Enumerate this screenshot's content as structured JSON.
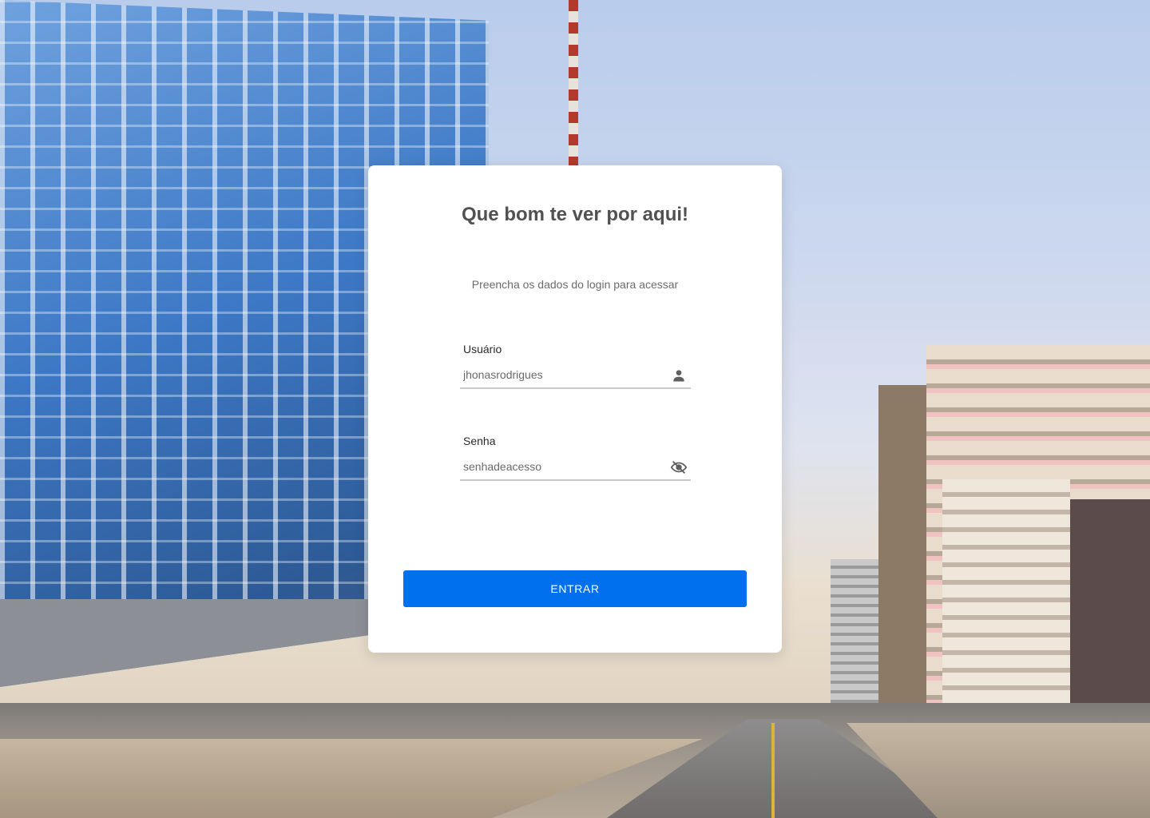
{
  "colors": {
    "accent": "#0070EE",
    "card_bg": "#FFFFFF",
    "title_text": "#515151",
    "input_border": "#C9C9C9"
  },
  "login": {
    "title": "Que bom te ver por aqui!",
    "subtitle": "Preencha os dados do login para acessar",
    "username": {
      "label": "Usuário",
      "placeholder": "jhonasrodrigues",
      "value": "",
      "icon": "person-icon"
    },
    "password": {
      "label": "Senha",
      "placeholder": "senhadeacesso",
      "value": "",
      "icon": "eye-off-icon"
    },
    "submit_label": "ENTRAR"
  }
}
